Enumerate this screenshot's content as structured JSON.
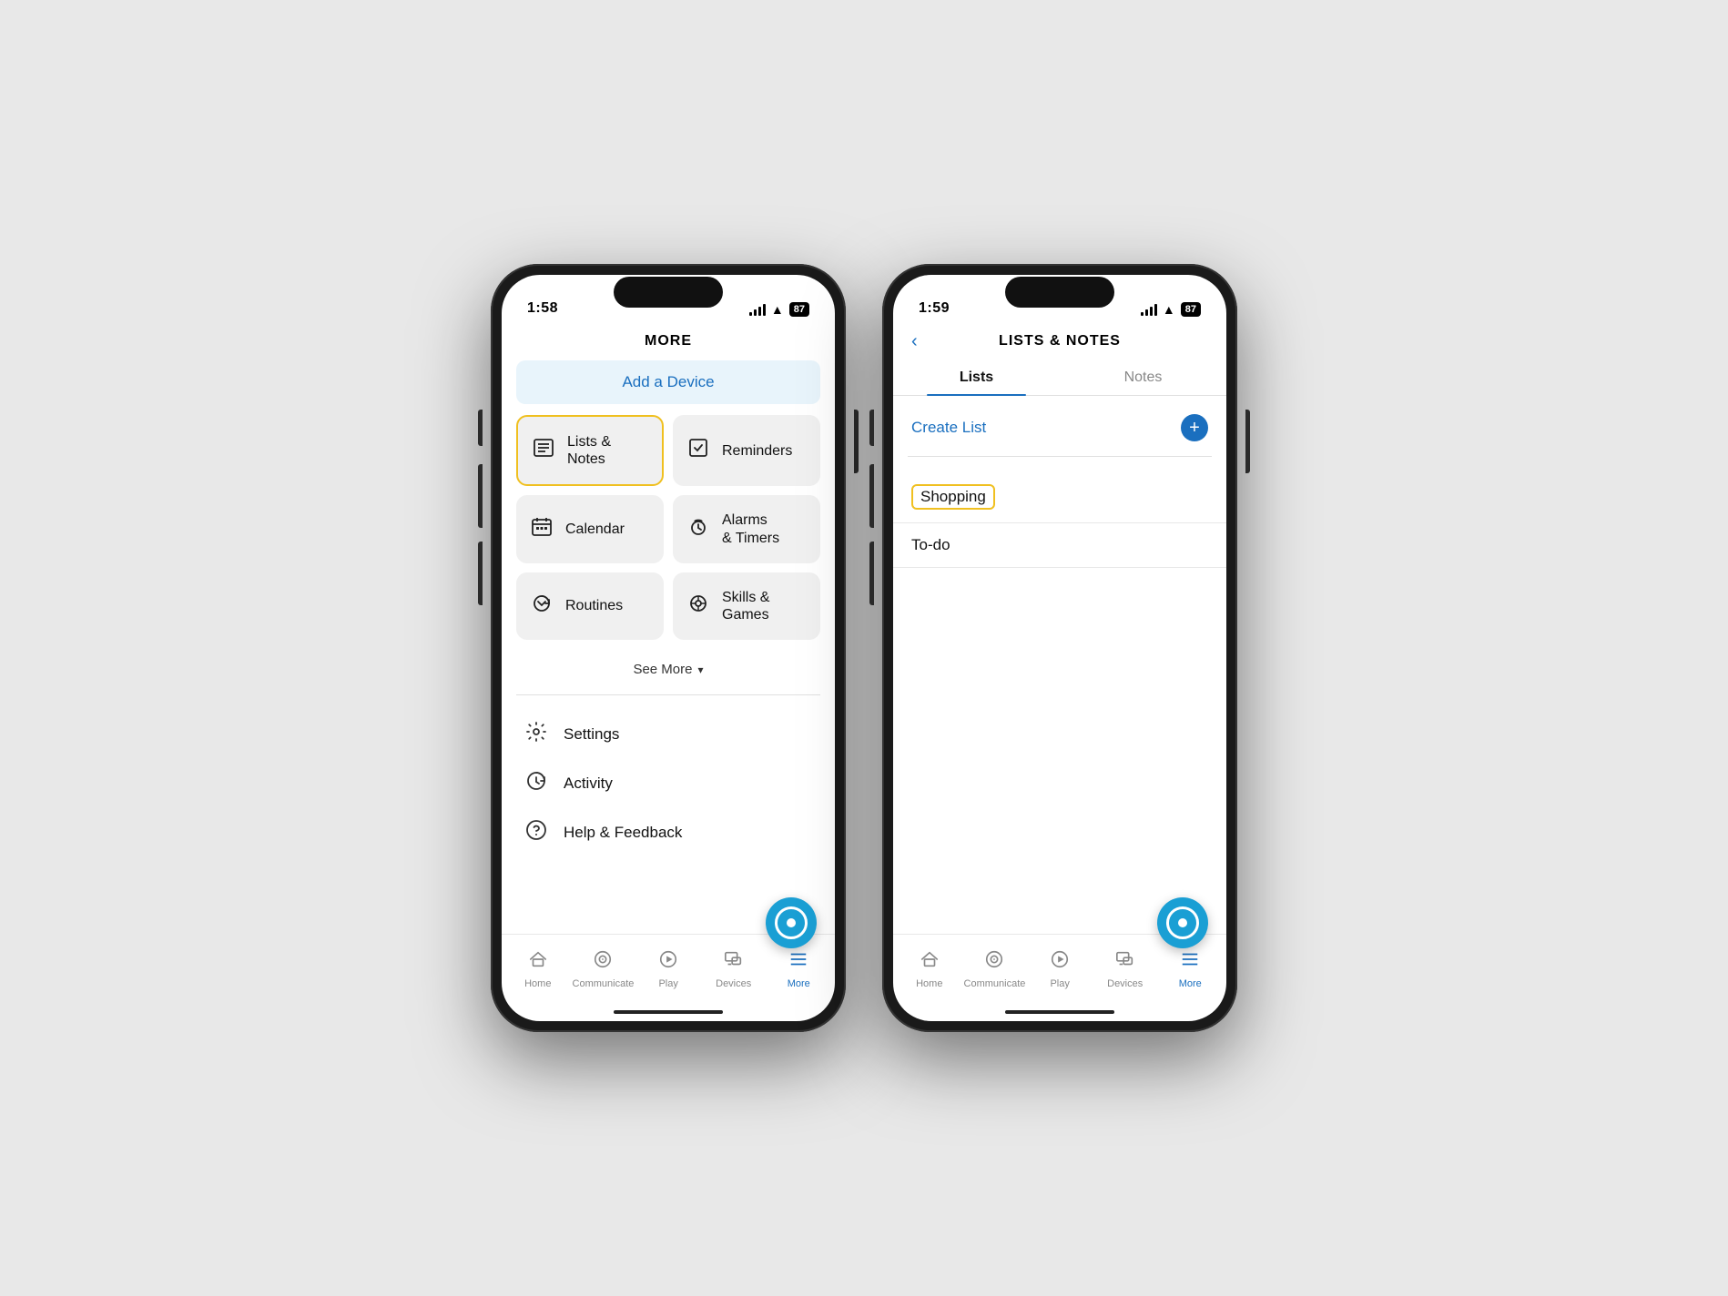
{
  "phone1": {
    "status": {
      "time": "1:58",
      "battery": "87"
    },
    "header": {
      "title": "MORE"
    },
    "add_device": {
      "label": "Add a Device"
    },
    "menu_items": [
      {
        "id": "lists-notes",
        "icon": "≡",
        "label": "Lists & Notes",
        "highlighted": true
      },
      {
        "id": "reminders",
        "icon": "✓",
        "label": "Reminders",
        "highlighted": false
      },
      {
        "id": "calendar",
        "icon": "▦",
        "label": "Calendar",
        "highlighted": false
      },
      {
        "id": "alarms-timers",
        "icon": "💬",
        "label": "Alarms & Timers",
        "highlighted": false
      },
      {
        "id": "routines",
        "icon": "↺",
        "label": "Routines",
        "highlighted": false
      },
      {
        "id": "skills-games",
        "icon": "⊙",
        "label": "Skills & Games",
        "highlighted": false
      }
    ],
    "see_more": "See More",
    "settings_items": [
      {
        "id": "settings",
        "icon": "⚙",
        "label": "Settings"
      },
      {
        "id": "activity",
        "icon": "↺",
        "label": "Activity"
      },
      {
        "id": "help",
        "icon": "?",
        "label": "Help & Feedback"
      }
    ],
    "bottom_nav": [
      {
        "id": "home",
        "icon": "⌂",
        "label": "Home",
        "active": false
      },
      {
        "id": "communicate",
        "icon": "●",
        "label": "Communicate",
        "active": false
      },
      {
        "id": "play",
        "icon": "▶",
        "label": "Play",
        "active": false
      },
      {
        "id": "devices",
        "icon": "⌂",
        "label": "Devices",
        "active": false
      },
      {
        "id": "more",
        "icon": "≡",
        "label": "More",
        "active": true
      }
    ]
  },
  "phone2": {
    "status": {
      "time": "1:59",
      "battery": "87"
    },
    "header": {
      "title": "LISTS & NOTES"
    },
    "tabs": [
      {
        "id": "lists",
        "label": "Lists",
        "active": true
      },
      {
        "id": "notes",
        "label": "Notes",
        "active": false
      }
    ],
    "create_list": "Create List",
    "list_items": [
      {
        "id": "shopping",
        "label": "Shopping",
        "highlighted": true
      },
      {
        "id": "todo",
        "label": "To-do",
        "highlighted": false
      }
    ],
    "bottom_nav": [
      {
        "id": "home",
        "icon": "⌂",
        "label": "Home",
        "active": false
      },
      {
        "id": "communicate",
        "icon": "●",
        "label": "Communicate",
        "active": false
      },
      {
        "id": "play",
        "icon": "▶",
        "label": "Play",
        "active": false
      },
      {
        "id": "devices",
        "icon": "⌂",
        "label": "Devices",
        "active": false
      },
      {
        "id": "more",
        "icon": "≡",
        "label": "More",
        "active": true
      }
    ]
  }
}
